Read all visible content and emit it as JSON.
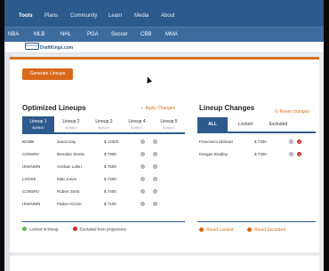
{
  "top_nav": {
    "items": [
      "Tools",
      "Plans",
      "Community",
      "Learn",
      "Media",
      "About"
    ],
    "active": "Tools"
  },
  "sub_nav": {
    "items": [
      "NBA",
      "MLB",
      "NHL",
      "PGA",
      "Soccer",
      "CBB",
      "MMA"
    ]
  },
  "brand": {
    "name": "DraftKings.com",
    "logo_text": "RotoGrinders"
  },
  "generate_button": "Generate Lineups",
  "optimized": {
    "title": "Optimized Lineups",
    "apply_label": "Apply Changes",
    "tabs": [
      {
        "name": "Lineup 1",
        "salary": "$49800"
      },
      {
        "name": "Lineup 2",
        "salary": "$49800"
      },
      {
        "name": "Lineup 3",
        "salary": "$49200"
      },
      {
        "name": "Lineup 4",
        "salary": "$49900"
      },
      {
        "name": "Lineup 5",
        "salary": "$49600"
      }
    ],
    "active_tab": 0,
    "rows": [
      {
        "status": "BOMB",
        "player": "Jason Day",
        "salary": "$ 12000"
      },
      {
        "status": "CONSRV",
        "player": "Brendan Steele",
        "salary": "$ 7800"
      },
      {
        "status": "UNKNWN",
        "player": "Anirban Lahiri",
        "salary": "$ 7500"
      },
      {
        "status": "LOOSE",
        "player": "Matt Jones",
        "salary": "$ 7400"
      },
      {
        "status": "CONSRV",
        "player": "Robert Streb",
        "salary": "$ 7400"
      },
      {
        "status": "UNKNWN",
        "player": "Patton Kizzire",
        "salary": "$ 7100"
      }
    ]
  },
  "changes": {
    "title": "Lineup Changes",
    "reset_label": "Reset changes",
    "tabs": [
      "ALL",
      "Locked",
      "Excluded"
    ],
    "active_tab": 0,
    "rows": [
      {
        "player": "Francesco Molinari",
        "salary": "$ 7300"
      },
      {
        "player": "Keegan Bradley",
        "salary": "$ 7300"
      }
    ]
  },
  "legend": {
    "locked": "Locked in lineup",
    "excluded": "Excluded from projections"
  },
  "reset_locked": "Reset Locked",
  "reset_excluded": "Reset Excluded",
  "colors": {
    "nav": "#2d5a8c",
    "accent": "#d8691b",
    "locked": "#5cb85c",
    "excluded": "#c9302c"
  }
}
